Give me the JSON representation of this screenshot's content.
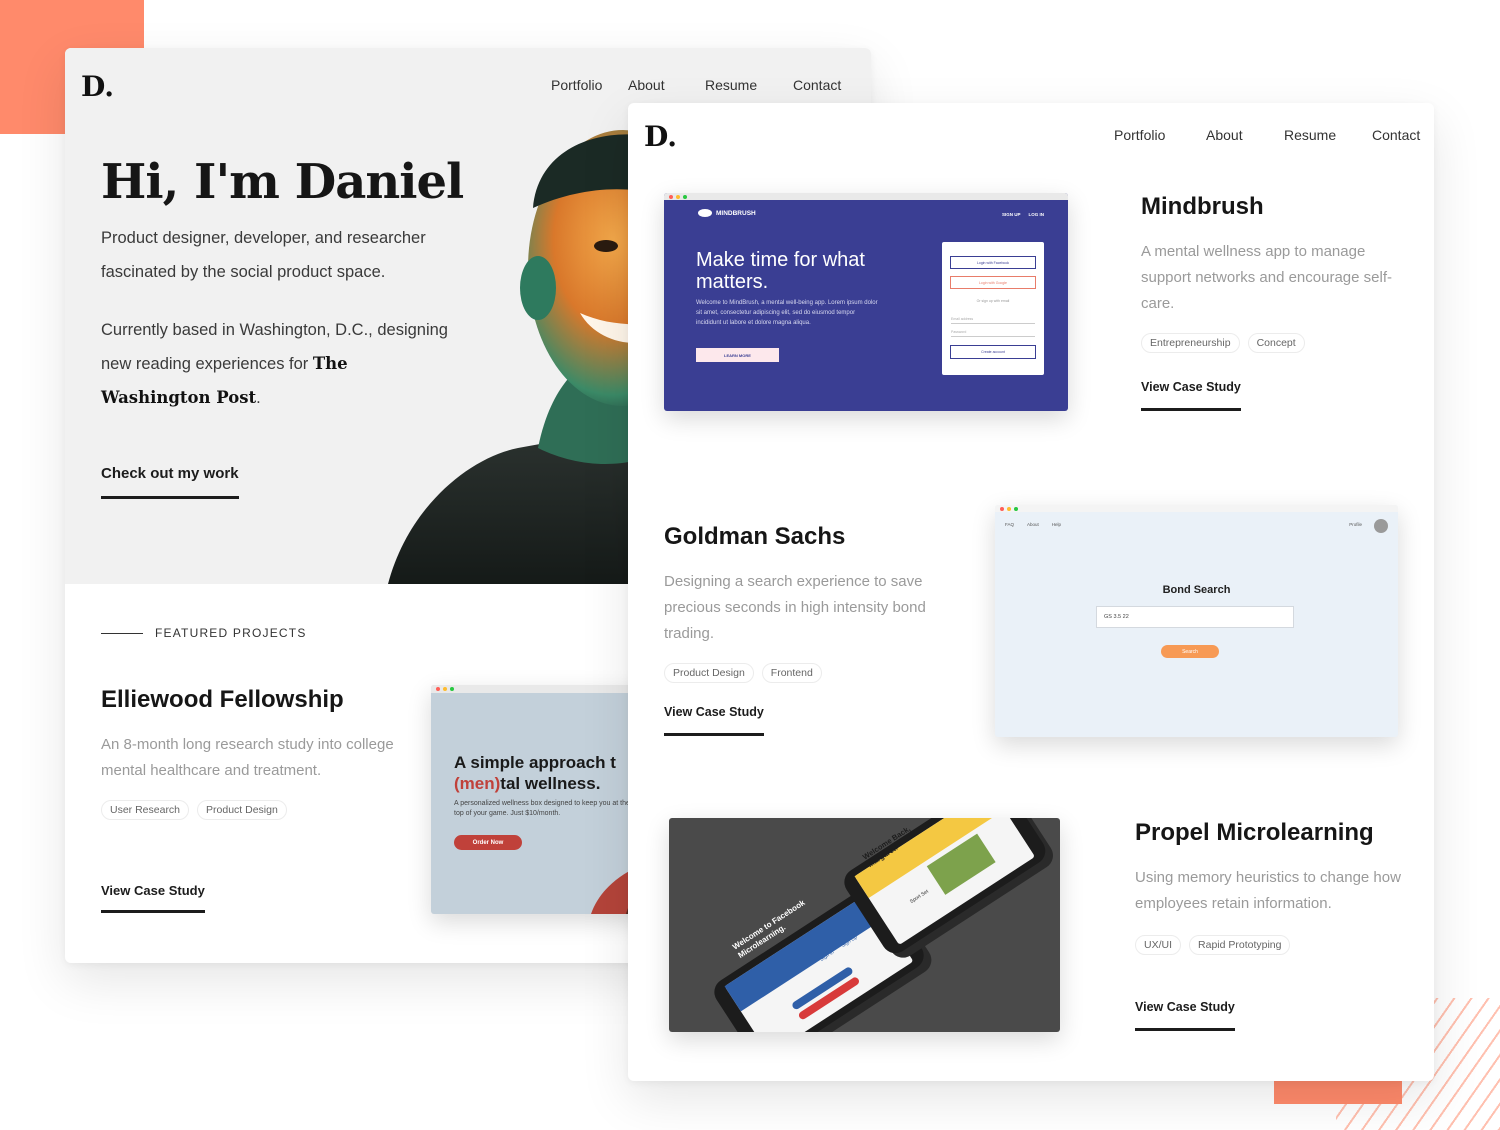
{
  "colors": {
    "accent": "#FF8A6B",
    "mindbrush_bg": "#3A3E93",
    "bond_bg": "#EAF1F8",
    "bond_button": "#F79A55",
    "propel_bg": "#4A4A4A",
    "elliewood_button": "#C0413A"
  },
  "left_page": {
    "logo": "D.",
    "nav": [
      "Portfolio",
      "About",
      "Resume",
      "Contact"
    ],
    "hero": {
      "heading": "Hi, I'm Daniel",
      "intro": "Product designer, developer, and researcher fascinated by the social product space.",
      "location_text": "Currently based in Washington, D.C., designing new reading experiences for ",
      "employer": "The Washington Post",
      "location_end": ".",
      "cta": "Check out my work"
    },
    "featured_label": "FEATURED PROJECTS",
    "project": {
      "title": "Elliewood Fellowship",
      "description": "An 8-month long research study into college mental healthcare and treatment.",
      "tags": [
        "User Research",
        "Product Design"
      ],
      "link": "View Case Study",
      "preview": {
        "headline_1": "A simple approach t",
        "headline_2_accent": "(men)",
        "headline_2_rest": "tal wellness.",
        "body": "A personalized wellness box designed to keep you at the top of your game. Just $10/month.",
        "button": "Order Now"
      }
    }
  },
  "right_page": {
    "logo": "D.",
    "nav": [
      "Portfolio",
      "About",
      "Resume",
      "Contact"
    ],
    "projects": [
      {
        "title": "Mindbrush",
        "description": "A mental wellness app to manage support networks and encourage self-care.",
        "tags": [
          "Entrepreneurship",
          "Concept"
        ],
        "link": "View Case Study",
        "preview": {
          "brand": "MINDBRUSH",
          "nav_links": [
            "SIGN UP",
            "LOG IN"
          ],
          "headline": "Make time for what matters.",
          "body": "Welcome to MindBrush, a mental well-being app. Lorem ipsum dolor sit amet, consectetur adipiscing elit, sed do eiusmod tempor incididunt ut labore et dolore magna aliqua.",
          "button": "LEARN MORE",
          "form": {
            "facebook": "Login with Facebook",
            "google": "Login with Google",
            "divider": "Or sign up with email",
            "email_placeholder": "Email address",
            "password_placeholder": "Password",
            "create": "Create account"
          }
        }
      },
      {
        "title": "Goldman Sachs",
        "description": "Designing a search experience to save precious seconds in high intensity bond trading.",
        "tags": [
          "Product Design",
          "Frontend"
        ],
        "link": "View Case Study",
        "preview": {
          "nav": [
            "FAQ",
            "About",
            "Help"
          ],
          "profile": "Profile",
          "title": "Bond Search",
          "query": "GS 3.5 22",
          "button": "Search"
        }
      },
      {
        "title": "Propel Microlearning",
        "description": "Using memory heuristics to change how employees retain information.",
        "tags": [
          "UX/UI",
          "Rapid Prototyping"
        ],
        "link": "View Case Study",
        "preview": {
          "phone1_title": "Welcome to Facebook Microlearning.",
          "phone1_tabs": [
            "Sign In",
            "Sign Up"
          ],
          "phone2_title": "Welcome Back, Margaret!",
          "phone2_subtitle": "Sport Set"
        }
      }
    ]
  }
}
